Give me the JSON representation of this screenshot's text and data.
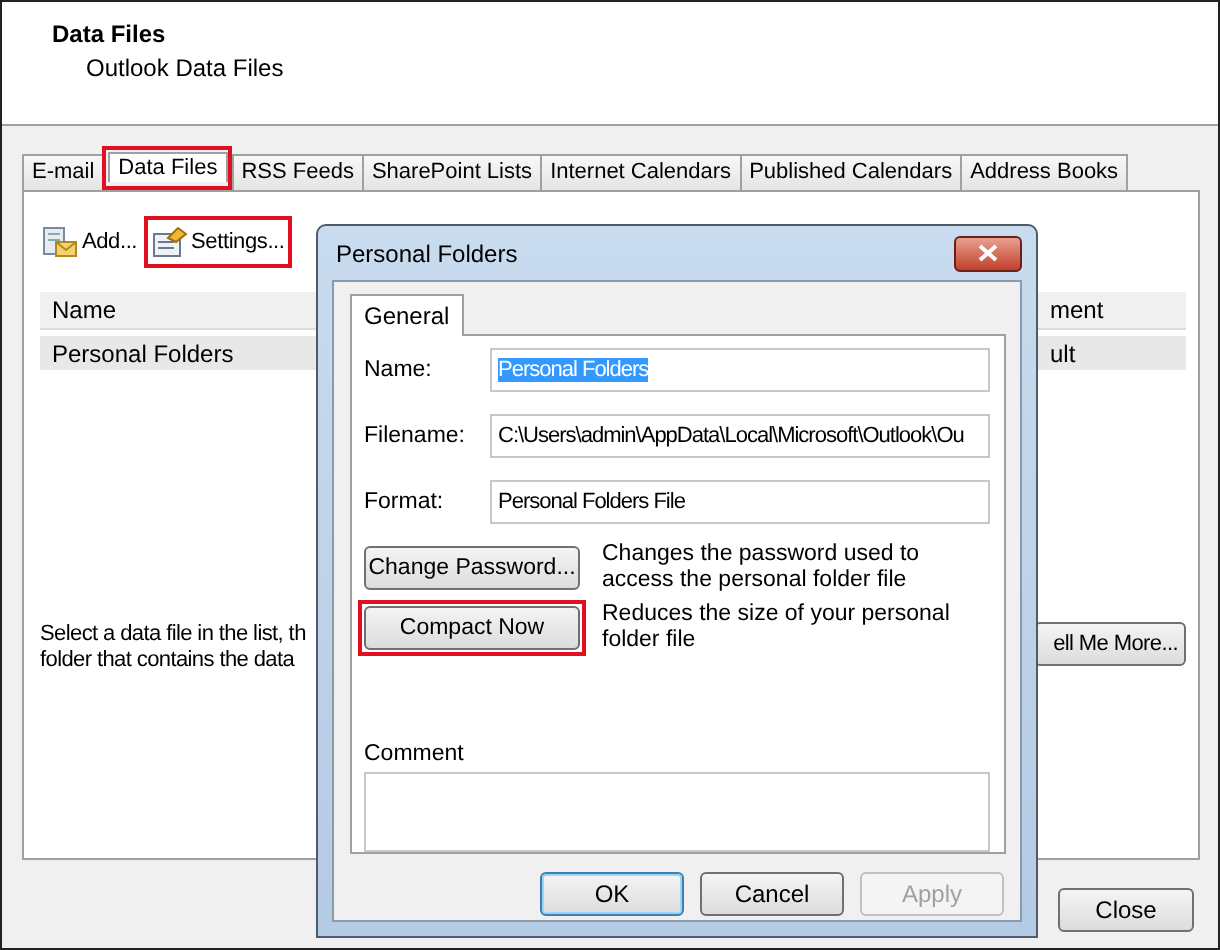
{
  "window": {
    "title": "Data Files",
    "subtitle": "Outlook Data Files"
  },
  "tabs": [
    {
      "label": "E-mail",
      "selected": false,
      "highlighted": false
    },
    {
      "label": "Data Files",
      "selected": true,
      "highlighted": true
    },
    {
      "label": "RSS Feeds",
      "selected": false,
      "highlighted": false
    },
    {
      "label": "SharePoint Lists",
      "selected": false,
      "highlighted": false
    },
    {
      "label": "Internet Calendars",
      "selected": false,
      "highlighted": false
    },
    {
      "label": "Published Calendars",
      "selected": false,
      "highlighted": false
    },
    {
      "label": "Address Books",
      "selected": false,
      "highlighted": false
    }
  ],
  "toolbar": [
    {
      "kind": "add",
      "label": "Add...",
      "highlighted": false
    },
    {
      "kind": "settings",
      "label": "Settings...",
      "highlighted": true
    }
  ],
  "list": {
    "columns": [
      "Name",
      "ment"
    ],
    "rows": [
      {
        "cells": [
          "Personal Folders",
          "ult"
        ],
        "selected": true
      }
    ]
  },
  "hint_lines": [
    "Select a data file in the list, th",
    "folder that contains the data"
  ],
  "tell_more_button": "ell Me More...",
  "close_button": "Close",
  "dialog": {
    "title": "Personal Folders",
    "tabs": [
      {
        "label": "General",
        "selected": true
      }
    ],
    "fields": [
      {
        "label": "Name:",
        "value": "Personal Folders",
        "text_selected": true
      },
      {
        "label": "Filename:",
        "value": "C:\\Users\\admin\\AppData\\Local\\Microsoft\\Outlook\\Ou",
        "text_selected": false
      },
      {
        "label": "Format:",
        "value": "Personal Folders File",
        "text_selected": false
      }
    ],
    "actions": [
      {
        "label": "Change Password...",
        "description": "Changes the password used to access the personal folder file",
        "highlighted": false
      },
      {
        "label": "Compact Now",
        "description": "Reduces the size of your personal folder file",
        "highlighted": true
      }
    ],
    "comment": {
      "label": "Comment"
    },
    "buttons": [
      {
        "label": "OK",
        "default": true,
        "disabled": false
      },
      {
        "label": "Cancel",
        "default": false,
        "disabled": false
      },
      {
        "label": "Apply",
        "default": false,
        "disabled": true
      }
    ]
  }
}
